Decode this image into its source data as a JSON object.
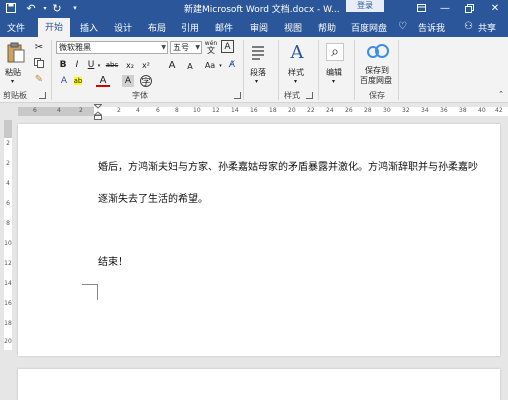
{
  "titlebar": {
    "doc_title": "新建Microsoft Word 文档.docx  -  W...",
    "login": "登录"
  },
  "tabs": [
    "文件",
    "开始",
    "插入",
    "设计",
    "布局",
    "引用",
    "邮件",
    "审阅",
    "视图",
    "帮助",
    "百度网盘"
  ],
  "tell_me": "告诉我",
  "share": "共享",
  "ribbon": {
    "clipboard": {
      "paste": "粘贴",
      "label": "剪贴板"
    },
    "font": {
      "font_name": "微软雅黑",
      "font_size": "五号",
      "wen_icon": "wén",
      "wen_char": "文",
      "bold": "B",
      "italic": "I",
      "underline": "U",
      "strike": "abc",
      "sub": "x₂",
      "sup": "x²",
      "grow": "A",
      "shrink": "A",
      "aa": "Aa",
      "highlight": "ab",
      "font_color": "A",
      "label": "字体"
    },
    "paragraph": {
      "label": "段落"
    },
    "styles": {
      "label": "样式"
    },
    "editing": {
      "label": "编辑"
    },
    "save": {
      "line1": "保存到",
      "line2": "百度网盘",
      "label": "保存"
    },
    "group_label_styles": "样式"
  },
  "ruler_numbers": [
    "6",
    "4",
    "2",
    "2",
    "4",
    "6",
    "8",
    "10",
    "12",
    "14",
    "16",
    "18",
    "20",
    "22",
    "24",
    "26",
    "28",
    "30",
    "32",
    "34",
    "36",
    "38",
    "40",
    "42"
  ],
  "vruler_numbers": [
    "2",
    "2",
    "4",
    "6",
    "8",
    "10",
    "12",
    "14",
    "16",
    "18",
    "20"
  ],
  "document": {
    "para1": "婚后，方鸿渐夫妇与方家、孙柔嘉姑母家的矛盾暴露并激化。方鸿渐辞职并与孙柔嘉吵",
    "para2": "逐渐失去了生活的希望。",
    "para3": "结束！"
  },
  "colors": {
    "accent": "#2b579a",
    "ribbon_bg": "#f3f3f3",
    "workspace": "#e6e6e6"
  }
}
